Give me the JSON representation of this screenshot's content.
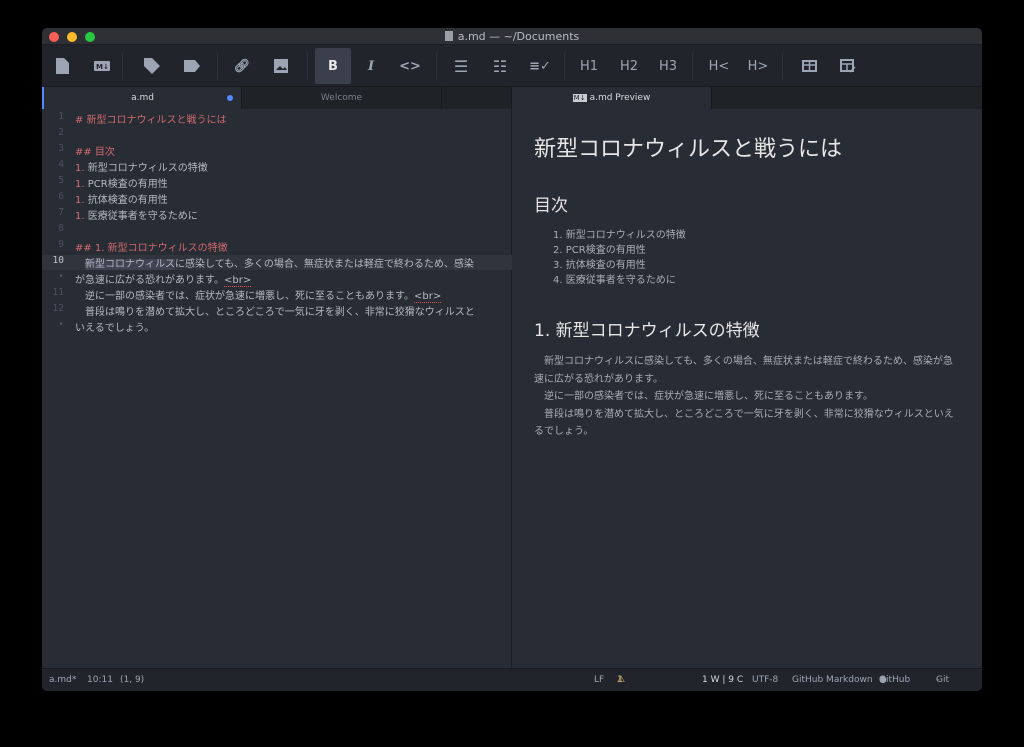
{
  "window": {
    "title": "a.md — ~/Documents"
  },
  "toolbar": {
    "bold": "B",
    "italic": "I",
    "code": "<>",
    "h1": "H1",
    "h2": "H2",
    "h3": "H3",
    "h_dec": "H<",
    "h_inc": "H>"
  },
  "tabs": [
    {
      "label": "a.md"
    },
    {
      "label": "Welcome"
    },
    {
      "label": "a.md Preview"
    }
  ],
  "editor": {
    "lines": [
      {
        "n": "1",
        "text": "# 新型コロナウィルスと戦うには"
      },
      {
        "n": "2",
        "text": ""
      },
      {
        "n": "3",
        "text": "## 目次"
      },
      {
        "n": "4",
        "mark": "1.",
        "text": "新型コロナウィルスの特徴"
      },
      {
        "n": "5",
        "mark": "1.",
        "text": "PCR検査の有用性"
      },
      {
        "n": "6",
        "mark": "1.",
        "text": "抗体検査の有用性"
      },
      {
        "n": "7",
        "mark": "1.",
        "text": "医療従事者を守るために"
      },
      {
        "n": "8",
        "text": ""
      },
      {
        "n": "9",
        "text": "## 1. 新型コロナウィルスの特徴"
      },
      {
        "n": "10",
        "sel": "新型コロナウィルス",
        "text": "に感染しても、多くの場合、無症状または軽症で終わるため、感染"
      },
      {
        "n": "•",
        "text": "が急速に広がる恐れがあります。",
        "tag": "<br>"
      },
      {
        "n": "11",
        "text": "　逆に一部の感染者では、症状が急速に増悪し、死に至ることもあります。",
        "tag": "<br>"
      },
      {
        "n": "12",
        "text": "　普段は鳴りを潜めて拡大し、ところどころで一気に牙を剥く、非常に狡猾なウィルスと"
      },
      {
        "n": "•",
        "text": "いえるでしょう。"
      }
    ]
  },
  "preview": {
    "h1": "新型コロナウィルスと戦うには",
    "h2_toc": "目次",
    "toc": [
      "新型コロナウィルスの特徴",
      "PCR検査の有用性",
      "抗体検査の有用性",
      "医療従事者を守るために"
    ],
    "toc_nums": [
      "1.",
      "2.",
      "3.",
      "4."
    ],
    "h2_section": "1. 新型コロナウィルスの特徴",
    "p1": "　新型コロナウィルスに感染しても、多くの場合、無症状または軽症で終わるため、感染が急速に広がる恐れがあります。",
    "p2": "　逆に一部の感染者では、症状が急速に増悪し、死に至ることもあります。",
    "p3": "　普段は鳴りを潜めて拡大し、ところどころで一気に牙を剥く、非常に狡猾なウィルスといえるでしょう。"
  },
  "status": {
    "file": "a.md*",
    "time": "10:11",
    "cursor": "(1, 9)",
    "eol": "LF",
    "deprecation": "1 deprecation",
    "wc": "1 W | 9 C",
    "encoding": "UTF-8",
    "grammar": "GitHub Markdown",
    "github": "GitHub",
    "git": "Git (0)"
  },
  "colors": {
    "accent": "#528bff",
    "heading": "#d06a6e",
    "warning": "#e5c07b"
  }
}
